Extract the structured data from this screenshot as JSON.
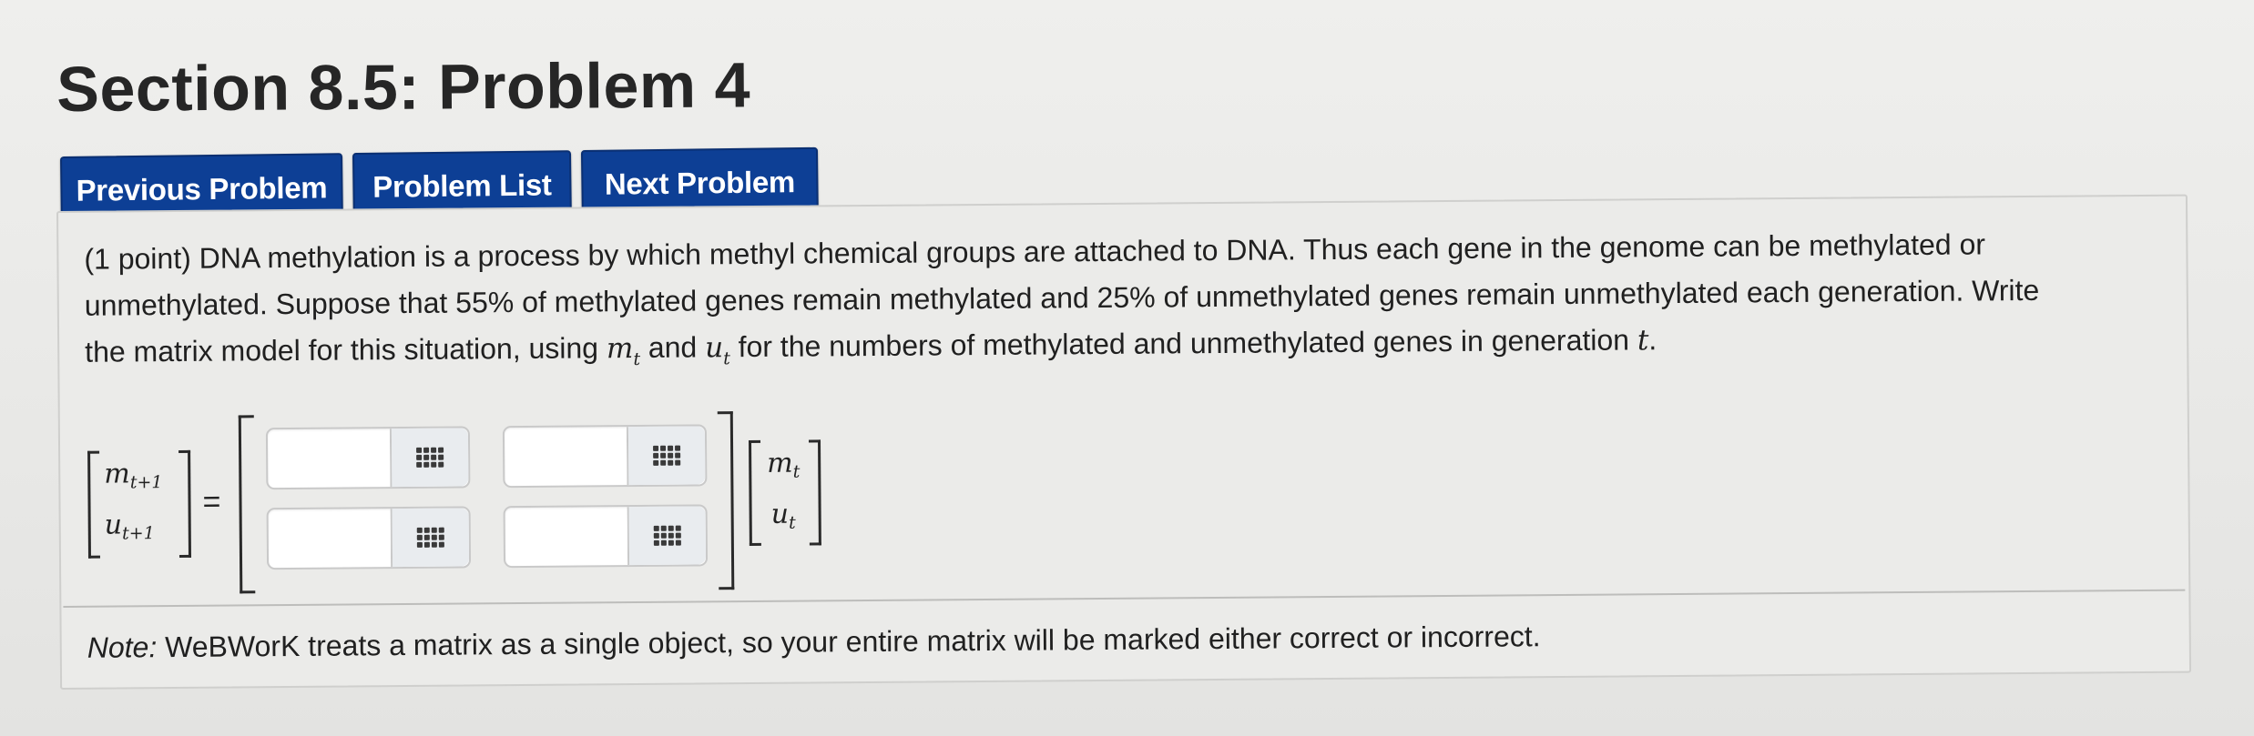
{
  "page": {
    "title": "Section 8.5: Problem 4"
  },
  "nav": {
    "previous_label": "Previous Problem",
    "list_label": "Problem List",
    "next_label": "Next Problem"
  },
  "problem": {
    "line1": "(1 point) DNA methylation is a process by which methyl chemical groups are attached to DNA. Thus each gene in the genome can be methylated or",
    "line2": "unmethylated. Suppose that 55% of methylated genes remain methylated and 25% of unmethylated genes remain unmethylated each generation. Write",
    "line3_prefix": "the matrix model for this situation, using",
    "var_m": "m",
    "var_u": "u",
    "sub_t": "t",
    "line3_mid": "and",
    "line3_suffix": "for the numbers of methylated and unmethylated genes in generation",
    "var_t": "t",
    "period": "."
  },
  "equation": {
    "lhs_top_var": "m",
    "lhs_top_sub": "t+1",
    "lhs_bottom_var": "u",
    "lhs_bottom_sub": "t+1",
    "equals": "=",
    "rhs_top_var": "m",
    "rhs_top_sub": "t",
    "rhs_bottom_var": "u",
    "rhs_bottom_sub": "t",
    "inputs": [
      {
        "value": "",
        "icon": "matrix-grid-icon"
      },
      {
        "value": "",
        "icon": "matrix-grid-icon"
      },
      {
        "value": "",
        "icon": "matrix-grid-icon"
      },
      {
        "value": "",
        "icon": "matrix-grid-icon"
      }
    ]
  },
  "note": {
    "label": "Note:",
    "text": " WeBWorK treats a matrix as a single object, so your entire matrix will be marked either correct or incorrect."
  },
  "colors": {
    "button_bg": "#0d3f95",
    "button_text": "#ffffff",
    "page_bg": "#e9e9e7"
  }
}
